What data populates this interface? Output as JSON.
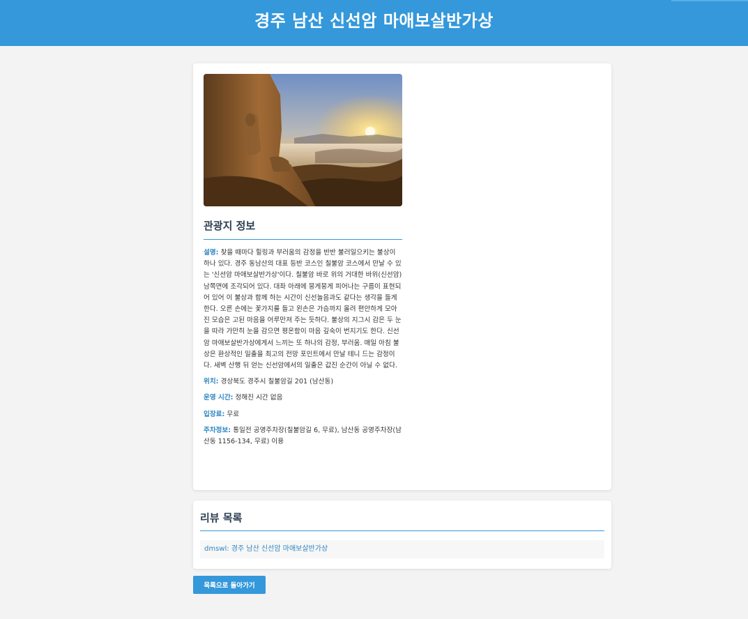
{
  "header": {
    "title": "경주 남산 신선암 마애보살반가상"
  },
  "info": {
    "section_title": "관광지 정보",
    "description_label": "설명:",
    "description": "찾을 때마다 힐링과 부러움의 감정을 반반 불러일으키는 불상이 하나 있다. 경주 동남산의 대표 등반 코스인 칠불암 코스에서 만날 수 있는 '신선암 마애보살반가상'이다. 칠불암 바로 위의 거대한 바위(신선암) 남쪽면에 조각되어 있다. 대좌 아래에 뭉게뭉게 피어나는 구름이 표현되어 있어 이 불상과 함께 하는 시간이 신선놀음과도 같다는 생각을 들게 한다. 오른 손에는 꽃가지를 들고 왼손은 가슴까지 올려 편안하게 모아진 모습은 고된 마음을 어루만져 주는 듯하다. 불상의 지그시 감은 두 눈을 따라 가만히 눈을 감으면 평온함이 마음 깊숙이 번지기도 한다. 신선암 마애보살반가상에게서 느끼는 또 하나의 감정, 부러움. 매일 아침 불상은 환상적인 일출을 최고의 전망 포인트에서 만날 테니 드는 감정이다. 새벽 산행 뒤 얻는 신선암에서의 일출은 값진 순간이 아닐 수 없다.",
    "location_label": "위치:",
    "location": "경상북도 경주시 칠불암길 201 (남산동)",
    "hours_label": "운영 시간:",
    "hours": "정해진 시간 없음",
    "fee_label": "입장료:",
    "fee": "무료",
    "parking_label": "주차정보:",
    "parking": "통일전 공영주차장(칠불암길 6, 무료), 남산동 공영주차장(남산동 1156-134, 무료) 이용"
  },
  "reviews": {
    "title": "리뷰 목록",
    "items": [
      {
        "text": "dmswl: 경주 남산 신선암 마애보살반가상"
      }
    ]
  },
  "back_button": "목록으로 돌아가기",
  "colors": {
    "accent": "#3498db",
    "label": "#2e86c1",
    "background": "#f3f3f3"
  }
}
